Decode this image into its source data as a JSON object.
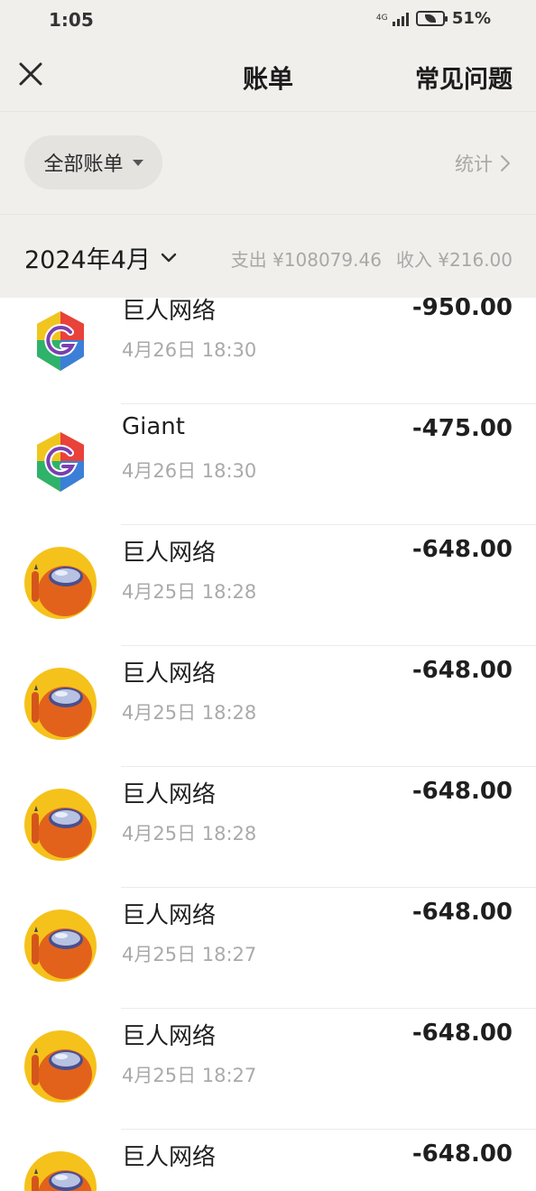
{
  "status_bar": {
    "time": "1:05",
    "network": "4G",
    "battery": "51%"
  },
  "header": {
    "title": "账单",
    "faq": "常见问题"
  },
  "filter": {
    "chip": "全部账单",
    "stats": "统计"
  },
  "month_bar": {
    "month": "2024年4月",
    "expense": "支出 ¥108079.46",
    "income": "收入 ¥216.00"
  },
  "transactions": [
    {
      "merchant": "巨人网络",
      "time": "4月26日 18:30",
      "amount": "-950.00",
      "icon": "giant-logo-icon"
    },
    {
      "merchant": "Giant",
      "time": "4月26日 18:30",
      "amount": "-475.00",
      "icon": "giant-logo-icon"
    },
    {
      "merchant": "巨人网络",
      "time": "4月25日 18:28",
      "amount": "-648.00",
      "icon": "orange-crewmate-avatar-icon"
    },
    {
      "merchant": "巨人网络",
      "time": "4月25日 18:28",
      "amount": "-648.00",
      "icon": "orange-crewmate-avatar-icon"
    },
    {
      "merchant": "巨人网络",
      "time": "4月25日 18:28",
      "amount": "-648.00",
      "icon": "orange-crewmate-avatar-icon"
    },
    {
      "merchant": "巨人网络",
      "time": "4月25日 18:27",
      "amount": "-648.00",
      "icon": "orange-crewmate-avatar-icon"
    },
    {
      "merchant": "巨人网络",
      "time": "4月25日 18:27",
      "amount": "-648.00",
      "icon": "orange-crewmate-avatar-icon"
    },
    {
      "merchant": "巨人网络",
      "time": "",
      "amount": "-648.00",
      "icon": "orange-crewmate-avatar-icon"
    }
  ]
}
